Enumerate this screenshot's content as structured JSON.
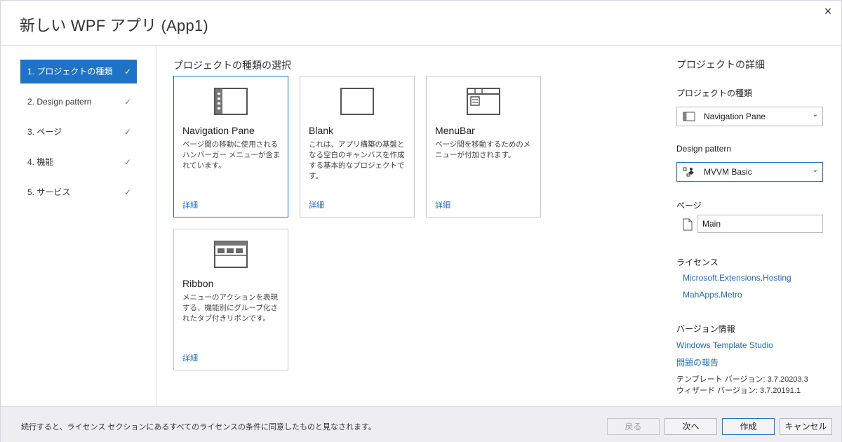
{
  "window": {
    "title": "新しい WPF アプリ (App1)",
    "close_icon": "×"
  },
  "steps": [
    {
      "label": "1. プロジェクトの種類",
      "active": true
    },
    {
      "label": "2. Design pattern",
      "active": false
    },
    {
      "label": "3. ページ",
      "active": false
    },
    {
      "label": "4. 機能",
      "active": false
    },
    {
      "label": "5. サービス",
      "active": false
    }
  ],
  "check_glyph": "✓",
  "center": {
    "section_title": "プロジェクトの種類の選択",
    "cards": [
      {
        "name": "Navigation Pane",
        "desc": "ページ間の移動に使用されるハンバーガー メニューが含まれています。",
        "link": "詳細",
        "icon": "navigation-pane-icon",
        "selected": true
      },
      {
        "name": "Blank",
        "desc": "これは、アプリ構築の基盤となる空白のキャンバスを作成する基本的なプロジェクトです。",
        "link": "詳細",
        "icon": "blank-icon",
        "selected": false
      },
      {
        "name": "MenuBar",
        "desc": "ページ間を移動するためのメニューが付加されます。",
        "link": "詳細",
        "icon": "menubar-icon",
        "selected": false
      },
      {
        "name": "Ribbon",
        "desc": "メニューのアクションを表現する、機能別にグループ化されたタブ付きリボンです。",
        "link": "詳細",
        "icon": "ribbon-icon",
        "selected": false
      }
    ]
  },
  "details": {
    "title": "プロジェクトの詳細",
    "project_type_label": "プロジェクトの種類",
    "project_type_value": "Navigation Pane",
    "design_pattern_label": "Design pattern",
    "design_pattern_value": "MVVM Basic",
    "page_label": "ページ",
    "page_value": "Main",
    "license_label": "ライセンス",
    "licenses": [
      "Microsoft.Extensions.Hosting",
      "MahApps.Metro"
    ],
    "version_label": "バージョン情報",
    "wts_link": "Windows Template Studio",
    "report_link": "問題の報告",
    "template_version": "テンプレート バージョン: 3.7.20203.3",
    "wizard_version": "ウィザード バージョン: 3.7.20191.1"
  },
  "footer": {
    "notice": "続行すると、ライセンス セクションにあるすべてのライセンスの条件に同意したものと見なされます。",
    "back_label": "戻る",
    "next_label": "次へ",
    "create_label": "作成",
    "cancel_label": "キャンセル"
  },
  "colors": {
    "accent": "#1e73c8",
    "link": "#1e6fc4"
  }
}
